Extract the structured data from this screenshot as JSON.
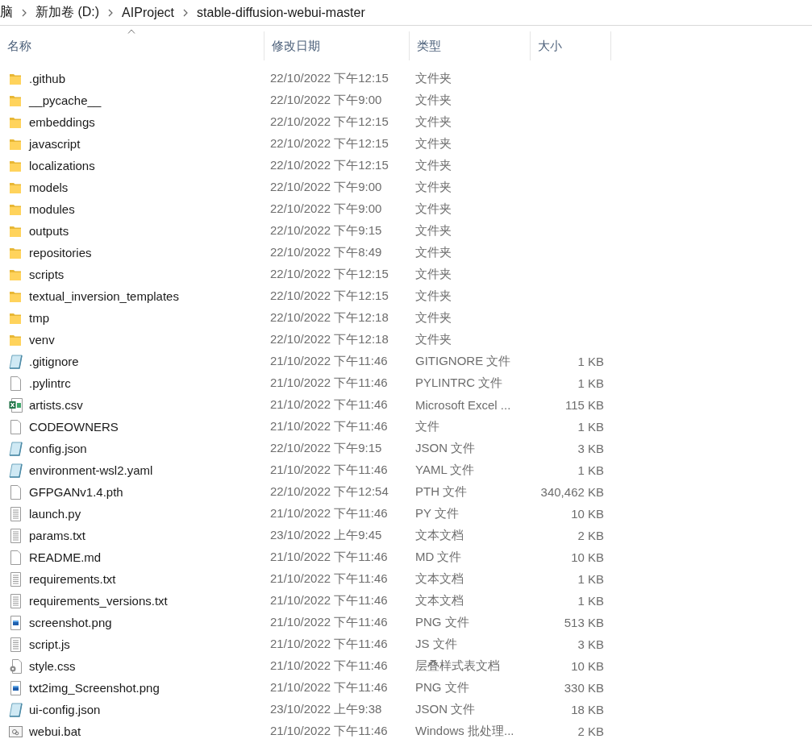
{
  "breadcrumb": [
    "脑",
    "新加卷 (D:)",
    "AIProject",
    "stable-diffusion-webui-master"
  ],
  "columns": [
    {
      "label": "名称",
      "sorted": true
    },
    {
      "label": "修改日期",
      "sorted": false
    },
    {
      "label": "类型",
      "sorted": false
    },
    {
      "label": "大小",
      "sorted": false
    }
  ],
  "rows": [
    {
      "kind": "folder",
      "name": ".github",
      "date": "22/10/2022 下午12:15",
      "type": "文件夹"
    },
    {
      "kind": "folder",
      "name": "__pycache__",
      "date": "22/10/2022 下午9:00",
      "type": "文件夹"
    },
    {
      "kind": "folder",
      "name": "embeddings",
      "date": "22/10/2022 下午12:15",
      "type": "文件夹"
    },
    {
      "kind": "folder",
      "name": "javascript",
      "date": "22/10/2022 下午12:15",
      "type": "文件夹"
    },
    {
      "kind": "folder",
      "name": "localizations",
      "date": "22/10/2022 下午12:15",
      "type": "文件夹"
    },
    {
      "kind": "folder",
      "name": "models",
      "date": "22/10/2022 下午9:00",
      "type": "文件夹"
    },
    {
      "kind": "folder",
      "name": "modules",
      "date": "22/10/2022 下午9:00",
      "type": "文件夹"
    },
    {
      "kind": "folder",
      "name": "outputs",
      "date": "22/10/2022 下午9:15",
      "type": "文件夹"
    },
    {
      "kind": "folder",
      "name": "repositories",
      "date": "22/10/2022 下午8:49",
      "type": "文件夹"
    },
    {
      "kind": "folder",
      "name": "scripts",
      "date": "22/10/2022 下午12:15",
      "type": "文件夹"
    },
    {
      "kind": "folder",
      "name": "textual_inversion_templates",
      "date": "22/10/2022 下午12:15",
      "type": "文件夹"
    },
    {
      "kind": "folder",
      "name": "tmp",
      "date": "22/10/2022 下午12:18",
      "type": "文件夹"
    },
    {
      "kind": "folder",
      "name": "venv",
      "date": "22/10/2022 下午12:18",
      "type": "文件夹"
    },
    {
      "kind": "notepad",
      "name": ".gitignore",
      "date": "21/10/2022 下午11:46",
      "type": "GITIGNORE 文件",
      "size": "1 KB"
    },
    {
      "kind": "blank",
      "name": ".pylintrc",
      "date": "21/10/2022 下午11:46",
      "type": "PYLINTRC 文件",
      "size": "1 KB"
    },
    {
      "kind": "excel",
      "name": "artists.csv",
      "date": "21/10/2022 下午11:46",
      "type": "Microsoft Excel ...",
      "size": "115 KB"
    },
    {
      "kind": "blank",
      "name": "CODEOWNERS",
      "date": "21/10/2022 下午11:46",
      "type": "文件",
      "size": "1 KB"
    },
    {
      "kind": "notepad",
      "name": "config.json",
      "date": "22/10/2022 下午9:15",
      "type": "JSON 文件",
      "size": "3 KB"
    },
    {
      "kind": "notepad",
      "name": "environment-wsl2.yaml",
      "date": "21/10/2022 下午11:46",
      "type": "YAML 文件",
      "size": "1 KB"
    },
    {
      "kind": "blank",
      "name": "GFPGANv1.4.pth",
      "date": "22/10/2022 下午12:54",
      "type": "PTH 文件",
      "size": "340,462 KB"
    },
    {
      "kind": "text",
      "name": "launch.py",
      "date": "21/10/2022 下午11:46",
      "type": "PY 文件",
      "size": "10 KB"
    },
    {
      "kind": "text",
      "name": "params.txt",
      "date": "23/10/2022 上午9:45",
      "type": "文本文档",
      "size": "2 KB"
    },
    {
      "kind": "blank",
      "name": "README.md",
      "date": "21/10/2022 下午11:46",
      "type": "MD 文件",
      "size": "10 KB"
    },
    {
      "kind": "text",
      "name": "requirements.txt",
      "date": "21/10/2022 下午11:46",
      "type": "文本文档",
      "size": "1 KB"
    },
    {
      "kind": "text",
      "name": "requirements_versions.txt",
      "date": "21/10/2022 下午11:46",
      "type": "文本文档",
      "size": "1 KB"
    },
    {
      "kind": "image",
      "name": "screenshot.png",
      "date": "21/10/2022 下午11:46",
      "type": "PNG 文件",
      "size": "513 KB"
    },
    {
      "kind": "text",
      "name": "script.js",
      "date": "21/10/2022 下午11:46",
      "type": "JS 文件",
      "size": "3 KB"
    },
    {
      "kind": "gear",
      "name": "style.css",
      "date": "21/10/2022 下午11:46",
      "type": "层叠样式表文档",
      "size": "10 KB"
    },
    {
      "kind": "image",
      "name": "txt2img_Screenshot.png",
      "date": "21/10/2022 下午11:46",
      "type": "PNG 文件",
      "size": "330 KB"
    },
    {
      "kind": "notepad",
      "name": "ui-config.json",
      "date": "23/10/2022 上午9:38",
      "type": "JSON 文件",
      "size": "18 KB"
    },
    {
      "kind": "batch",
      "name": "webui.bat",
      "date": "21/10/2022 下午11:46",
      "type": "Windows 批处理...",
      "size": "2 KB"
    }
  ]
}
